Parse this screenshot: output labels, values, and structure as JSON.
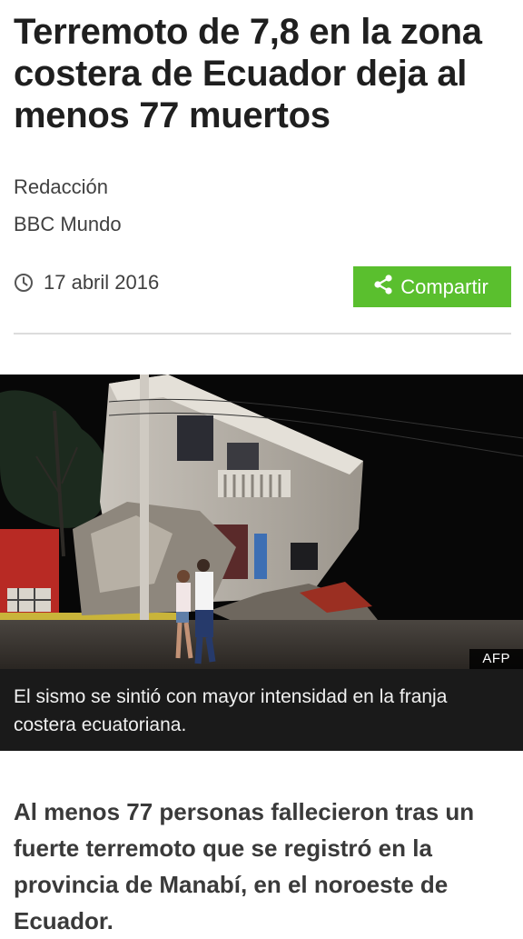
{
  "article": {
    "headline": "Terremoto de 7,8 en la zona costera de Ecuador deja al menos 77 muertos",
    "author": "Redacción",
    "organization": "BBC Mundo",
    "date": "17 abril 2016",
    "share_label": "Compartir",
    "image": {
      "credit": "AFP",
      "caption": "El sismo se sintió con mayor intensidad en la franja costera ecuatoriana."
    },
    "intro": "Al menos 77 personas fallecieron tras un fuerte terremoto que se registró en la provincia de Manabí, en el noroeste de Ecuador."
  },
  "icons": {
    "date": "clock-icon",
    "share": "share-icon"
  },
  "colors": {
    "share_button": "#5abf2e",
    "caption_background": "#1a1a1a",
    "text": "#222222"
  }
}
